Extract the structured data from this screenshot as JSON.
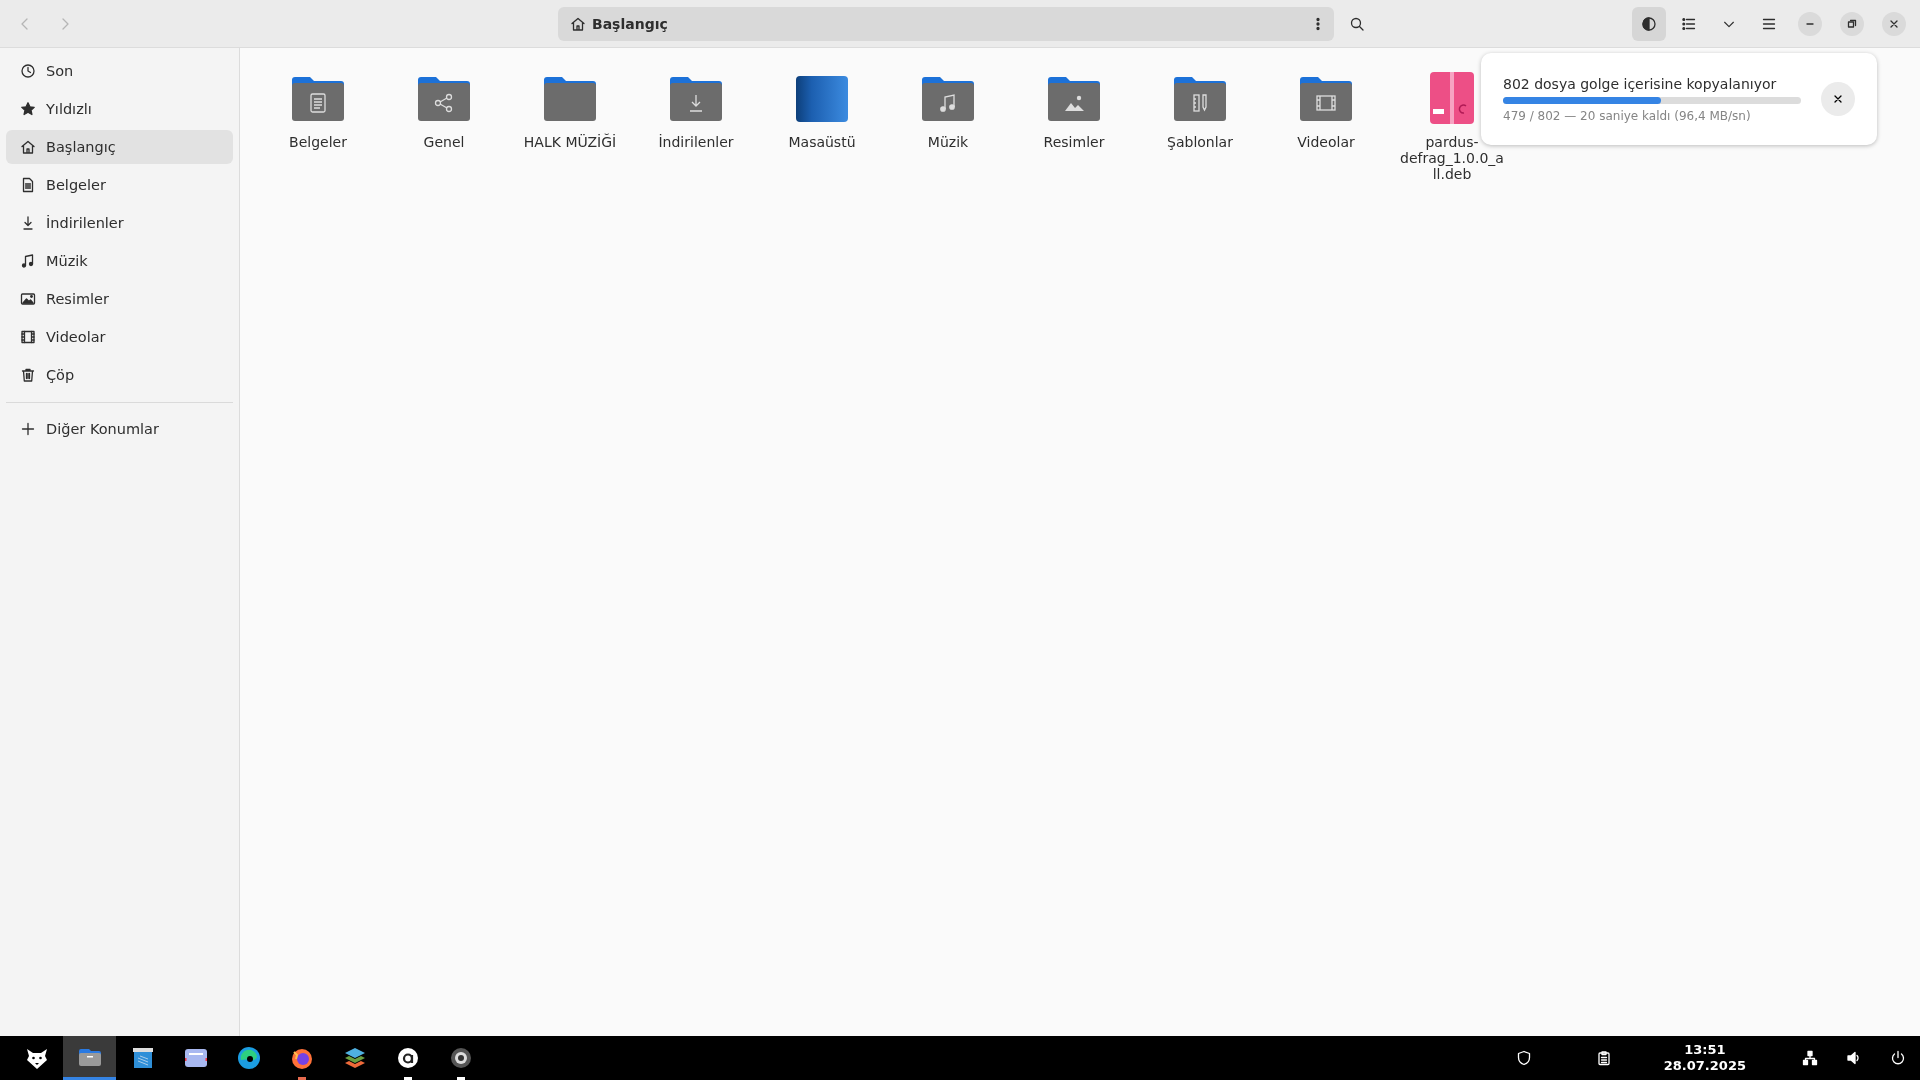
{
  "header": {
    "back_disabled": true,
    "forward_disabled": true,
    "path": "Başlangıç",
    "theme_button_pressed": true
  },
  "sidebar": {
    "items": [
      {
        "label": "Son",
        "kind": "recent",
        "selected": false
      },
      {
        "label": "Yıldızlı",
        "kind": "star",
        "selected": false
      },
      {
        "label": "Başlangıç",
        "kind": "home",
        "selected": true
      },
      {
        "label": "Belgeler",
        "kind": "document",
        "selected": false
      },
      {
        "label": "İndirilenler",
        "kind": "download",
        "selected": false
      },
      {
        "label": "Müzik",
        "kind": "music",
        "selected": false
      },
      {
        "label": "Resimler",
        "kind": "picture",
        "selected": false
      },
      {
        "label": "Videolar",
        "kind": "video",
        "selected": false
      },
      {
        "label": "Çöp",
        "kind": "trash",
        "selected": false
      }
    ],
    "other": {
      "label": "Diğer Konumlar",
      "kind": "plus"
    }
  },
  "files": [
    {
      "name": "Belgeler",
      "kind": "document"
    },
    {
      "name": "Genel",
      "kind": "share"
    },
    {
      "name": "HALK MÜZİĞİ",
      "kind": "folder"
    },
    {
      "name": "İndirilenler",
      "kind": "download"
    },
    {
      "name": "Masaüstü",
      "kind": "desktop"
    },
    {
      "name": "Müzik",
      "kind": "music"
    },
    {
      "name": "Resimler",
      "kind": "picture"
    },
    {
      "name": "Şablonlar",
      "kind": "template"
    },
    {
      "name": "Videolar",
      "kind": "video"
    },
    {
      "name": "pardus-defrag_1.0.0_all.deb",
      "kind": "package"
    }
  ],
  "progress_popover": {
    "title": "802 dosya golge içerisine kopyalanıyor",
    "level": 0.53,
    "status": "479 / 802 — 20 saniye kaldı (96,4 MB/sn)"
  },
  "taskbar": {
    "apps": [
      {
        "kind": "files",
        "selected": true,
        "running": true
      },
      {
        "kind": "archive",
        "selected": false,
        "running": false
      },
      {
        "kind": "mail",
        "selected": false,
        "running": false
      },
      {
        "kind": "edge",
        "selected": false,
        "running": false
      },
      {
        "kind": "firefox",
        "selected": false,
        "running": true
      },
      {
        "kind": "layers",
        "selected": false,
        "running": false
      },
      {
        "kind": "a",
        "selected": false,
        "running": true
      },
      {
        "kind": "speaker",
        "selected": false,
        "running": true
      }
    ],
    "time": "13:51",
    "date": "28.07.2025"
  }
}
